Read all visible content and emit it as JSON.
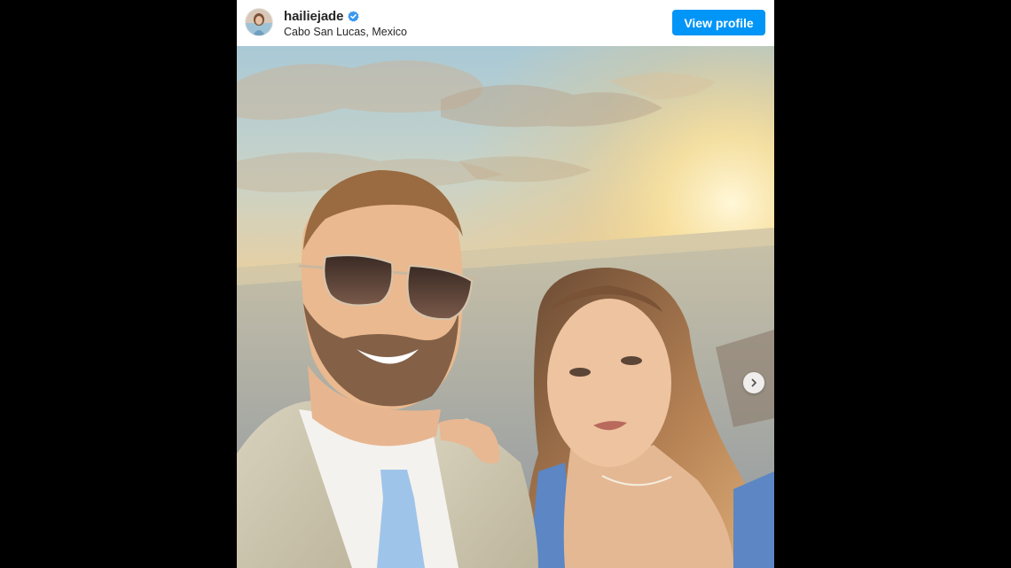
{
  "post": {
    "username": "hailiejade",
    "location": "Cabo San Lucas, Mexico",
    "verified": true,
    "view_profile_label": "View profile"
  },
  "icons": {
    "verified": "verified-badge-icon",
    "next": "chevron-right-icon"
  },
  "colors": {
    "button": "#0095f6",
    "verified": "#3897f0",
    "text": "#262626"
  }
}
